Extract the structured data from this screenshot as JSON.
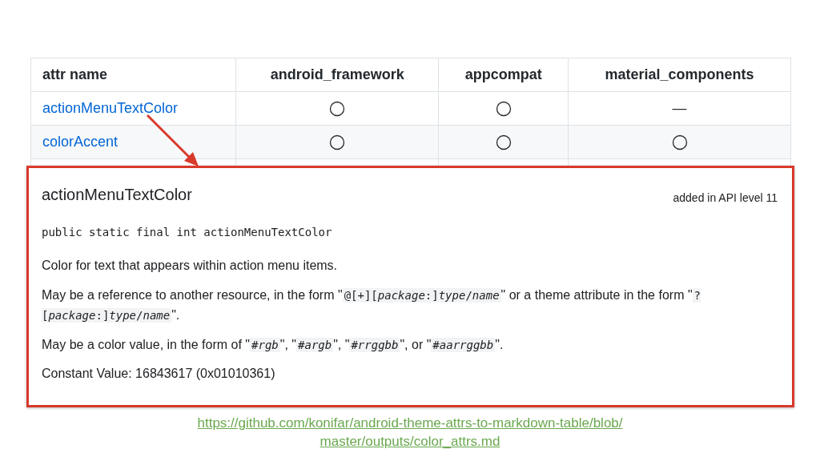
{
  "table": {
    "columns": [
      "attr name",
      "android_framework",
      "appcompat",
      "material_components"
    ],
    "rows": [
      {
        "cells": [
          {
            "kind": "link",
            "text": "actionMenuTextColor"
          },
          {
            "kind": "circle"
          },
          {
            "kind": "circle"
          },
          {
            "kind": "dash",
            "text": "—"
          }
        ]
      },
      {
        "cells": [
          {
            "kind": "link",
            "text": "colorAccent"
          },
          {
            "kind": "circle"
          },
          {
            "kind": "circle"
          },
          {
            "kind": "circle"
          }
        ]
      }
    ]
  },
  "doc": {
    "title": "actionMenuTextColor",
    "added": "added in API level 11",
    "signature": "public static final int actionMenuTextColor",
    "paragraphs": [
      [
        {
          "kind": "text",
          "text": "Color for text that appears within action menu items."
        }
      ],
      [
        {
          "kind": "text",
          "text": "May be a reference to another resource, in the form \""
        },
        {
          "kind": "code",
          "text": "@[+][*package*:]*type*/*name*"
        },
        {
          "kind": "text",
          "text": "\" or a theme attribute in the form \""
        },
        {
          "kind": "code",
          "text": "?[*package*:]*type*/*name*"
        },
        {
          "kind": "text",
          "text": "\"."
        }
      ],
      [
        {
          "kind": "text",
          "text": "May be a color value, in the form of \""
        },
        {
          "kind": "code",
          "text": "#*rgb*"
        },
        {
          "kind": "text",
          "text": "\", \""
        },
        {
          "kind": "code",
          "text": "#*argb*"
        },
        {
          "kind": "text",
          "text": "\", \""
        },
        {
          "kind": "code",
          "text": "#*rrggbb*"
        },
        {
          "kind": "text",
          "text": "\", or \""
        },
        {
          "kind": "code",
          "text": "#*aarrggbb*"
        },
        {
          "kind": "text",
          "text": "\"."
        }
      ],
      [
        {
          "kind": "text",
          "text": "Constant Value: 16843617 (0x01010361)"
        }
      ]
    ]
  },
  "source_link": [
    "https://github.com/konifar/android-theme-attrs-to-markdown-table/blob/",
    "master/outputs/color_attrs.md"
  ]
}
